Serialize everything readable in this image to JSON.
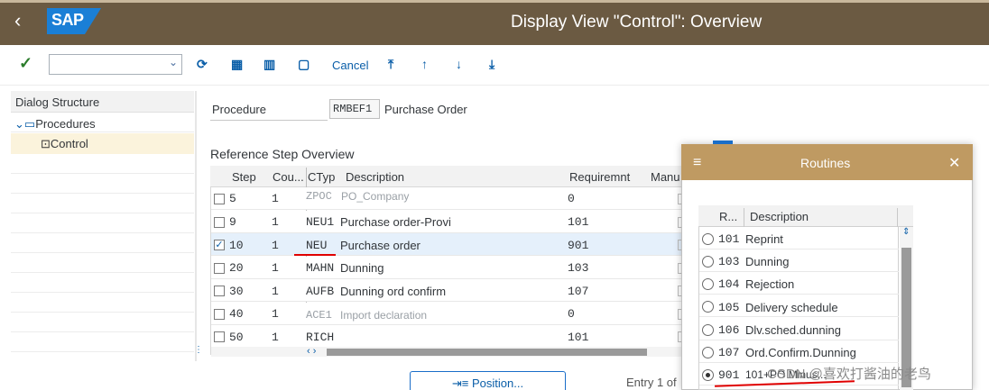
{
  "header": {
    "back_glyph": "‹",
    "logo": "SAP",
    "title": "Display View \"Control\": Overview"
  },
  "toolbar": {
    "confirm_glyph": "✓",
    "combo_value": "",
    "cancel_label": "Cancel"
  },
  "dialog_structure": {
    "heading": "Dialog Structure",
    "procedures_label": "Procedures",
    "control_label": "Control"
  },
  "form": {
    "procedure_label": "Procedure",
    "procedure_value": "RMBEF1",
    "procedure_desc": "Purchase Order"
  },
  "table": {
    "section_title": "Reference Step Overview",
    "headers": {
      "step": "Step",
      "counter": "Cou...",
      "ctyp": "CTyp",
      "description": "Description",
      "requirement": "Requiremnt",
      "manual": "Manu"
    },
    "rows": [
      {
        "step": "5",
        "counter": "1",
        "ctyp": "ZPOC",
        "description": "PO_Company",
        "req": "0",
        "checked": false,
        "selected": false
      },
      {
        "step": "9",
        "counter": "1",
        "ctyp": "NEU1",
        "description": "Purchase order-Provi",
        "req": "101",
        "checked": false,
        "selected": false
      },
      {
        "step": "10",
        "counter": "1",
        "ctyp": "NEU",
        "description": "Purchase order",
        "req": "901",
        "checked": true,
        "selected": true
      },
      {
        "step": "20",
        "counter": "1",
        "ctyp": "MAHN",
        "description": "Dunning",
        "req": "103",
        "checked": false,
        "selected": false
      },
      {
        "step": "30",
        "counter": "1",
        "ctyp": "AUFB",
        "description": "Dunning ord confirm",
        "req": "107",
        "checked": false,
        "selected": false
      },
      {
        "step": "40",
        "counter": "1",
        "ctyp": "ACE1",
        "description": "Import declaration",
        "req": "0",
        "checked": false,
        "selected": false
      },
      {
        "step": "50",
        "counter": "1",
        "ctyp": "RICH",
        "description": "",
        "req": "101",
        "checked": false,
        "selected": false
      }
    ],
    "scroll_arrows": "‹ ›",
    "position_button": "⇥≡ Position...",
    "entry_text": "Entry 1 of"
  },
  "popup": {
    "title": "Routines",
    "menu_glyph": "≡",
    "close_glyph": "✕",
    "headers": {
      "routine": "R...",
      "description": "Description"
    },
    "rows": [
      {
        "code": "101",
        "desc": "Reprint",
        "selected": false
      },
      {
        "code": "103",
        "desc": "Dunning",
        "selected": false
      },
      {
        "code": "104",
        "desc": "Rejection",
        "selected": false
      },
      {
        "code": "105",
        "desc": "Delivery schedule",
        "selected": false
      },
      {
        "code": "106",
        "desc": "Dlv.sched.dunning",
        "selected": false
      },
      {
        "code": "107",
        "desc": "Ord.Confirm.Dunning",
        "selected": false
      },
      {
        "code": "901",
        "desc": "101+PO Minus...",
        "selected": true
      }
    ]
  },
  "watermark": "CSDN @喜欢打酱油的老鸟",
  "colors": {
    "title_bar": "#6b5a42",
    "popup_header": "#bf9a62",
    "annotation_red": "#e00000",
    "link_blue": "#0a5ea8"
  }
}
